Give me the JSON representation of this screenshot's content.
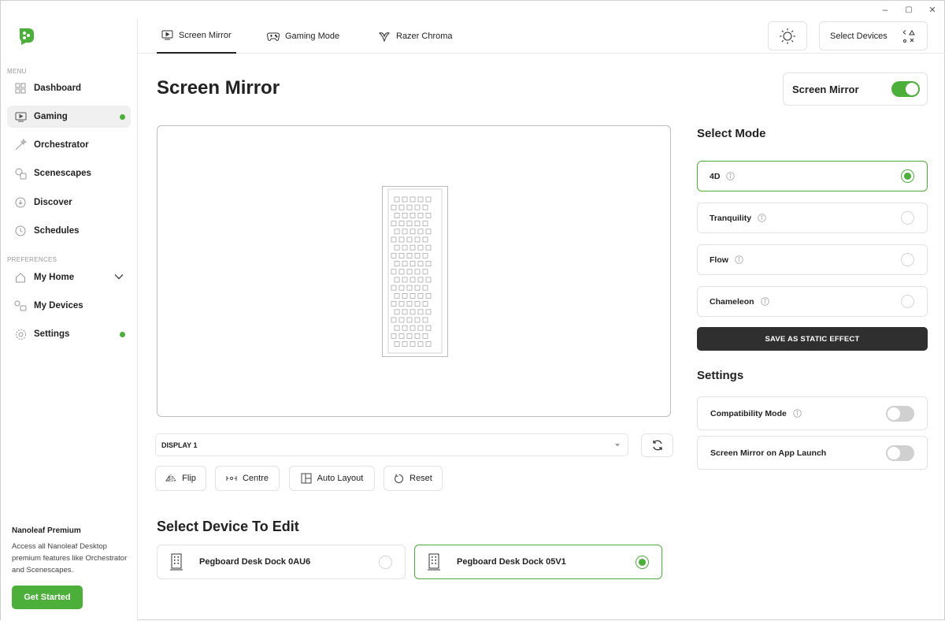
{
  "window": {
    "controls": [
      "–",
      "▢",
      "✕"
    ]
  },
  "sidebar": {
    "menu_label": "MENU",
    "preferences_label": "PREFERENCES",
    "items": [
      {
        "label": "Dashboard",
        "icon": "dashboard-icon"
      },
      {
        "label": "Gaming",
        "icon": "monitor-play-icon",
        "active": true,
        "dot": true
      },
      {
        "label": "Orchestrator",
        "icon": "wand-icon"
      },
      {
        "label": "Scenescapes",
        "icon": "scenes-icon"
      },
      {
        "label": "Discover",
        "icon": "discover-icon"
      },
      {
        "label": "Schedules",
        "icon": "clock-icon"
      }
    ],
    "pref_items": [
      {
        "label": "My Home",
        "icon": "home-icon",
        "chevron": true
      },
      {
        "label": "My Devices",
        "icon": "devices-icon"
      },
      {
        "label": "Settings",
        "icon": "gear-icon",
        "dot": true
      }
    ],
    "premium": {
      "title": "Nanoleaf Premium",
      "text": "Access all Nanoleaf Desktop premium features like Orchestrator and Scenescapes.",
      "button": "Get Started"
    }
  },
  "tabs": [
    {
      "label": "Screen Mirror",
      "icon": "monitor-play-icon",
      "active": true
    },
    {
      "label": "Gaming Mode",
      "icon": "gamepad-icon"
    },
    {
      "label": "Razer Chroma",
      "icon": "razer-icon"
    }
  ],
  "topbar": {
    "select_devices": "Select Devices"
  },
  "main": {
    "title": "Screen Mirror",
    "toggle_label": "Screen Mirror",
    "toggle_on": true,
    "display_select": "DISPLAY 1",
    "tools": [
      "Flip",
      "Centre",
      "Auto Layout",
      "Reset"
    ],
    "select_device_title": "Select Device To Edit",
    "devices": [
      {
        "name": "Pegboard Desk Dock 0AU6",
        "selected": false
      },
      {
        "name": "Pegboard Desk Dock 05V1",
        "selected": true
      }
    ]
  },
  "right": {
    "select_mode_title": "Select Mode",
    "modes": [
      {
        "label": "4D",
        "selected": true
      },
      {
        "label": "Tranquility",
        "selected": false
      },
      {
        "label": "Flow",
        "selected": false
      },
      {
        "label": "Chameleon",
        "selected": false
      }
    ],
    "save_button": "SAVE AS STATIC EFFECT",
    "settings_title": "Settings",
    "settings": [
      {
        "label": "Compatibility Mode",
        "info": true,
        "on": false
      },
      {
        "label": "Screen Mirror on App Launch",
        "info": false,
        "on": false
      }
    ]
  },
  "colors": {
    "accent": "#4caf3a",
    "dark_button": "#2f2f2f",
    "border": "#e2e2e2"
  }
}
